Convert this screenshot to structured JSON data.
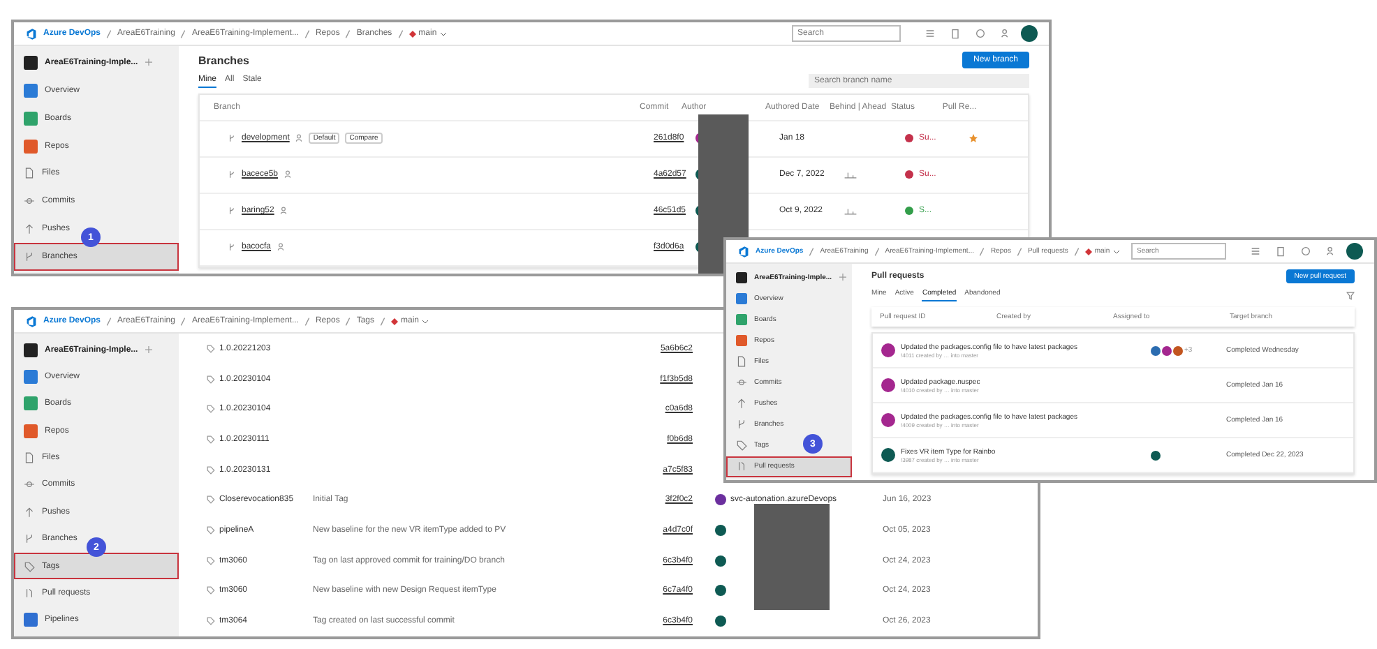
{
  "windows": [
    {
      "kind": "branches",
      "brand": "Azure DevOps",
      "crumbs": [
        "AreaE6Training",
        "AreaE6Training-Implement...",
        "Repos",
        "Branches"
      ],
      "branch": "main",
      "search_placeholder": "Search",
      "project": "AreaE6Training-Imple...",
      "step_badge": "1",
      "nav": [
        {
          "label": "Overview",
          "kind": "service",
          "color": "#2b7bd6",
          "selected": false
        },
        {
          "label": "Boards",
          "kind": "service",
          "color": "#2fa36b",
          "selected": false
        },
        {
          "label": "Repos",
          "kind": "service",
          "color": "#e0592a",
          "selected": false
        },
        {
          "label": "Files",
          "kind": "files",
          "selected": false
        },
        {
          "label": "Commits",
          "kind": "commits",
          "selected": false
        },
        {
          "label": "Pushes",
          "kind": "pushes",
          "selected": false
        },
        {
          "label": "Branches",
          "kind": "branches",
          "selected": true
        }
      ],
      "title": "Branches",
      "tabs": [
        {
          "label": "Mine",
          "selected": true
        },
        {
          "label": "All",
          "selected": false
        },
        {
          "label": "Stale",
          "selected": false
        }
      ],
      "button": "New branch",
      "filter_placeholder": "Search branch name",
      "columns": [
        "Branch",
        "Commit",
        "Author",
        "Authored Date",
        "Behind | Ahead",
        "Status",
        "Pull Re..."
      ],
      "rows": [
        {
          "name": "development",
          "tags": [
            "Default",
            "Compare"
          ],
          "commit": "261d8f0",
          "color": "#a4278f",
          "date": "Jan 18",
          "graph": false,
          "status": {
            "text": "Su...",
            "color": "#c4314b"
          },
          "pr_icon": true
        },
        {
          "name": "bacece5b",
          "tags": [],
          "commit": "4a62d57",
          "color": "#0e5a53",
          "date": "Dec 7, 2022",
          "graph": true,
          "status": {
            "text": "Su...",
            "color": "#c4314b"
          },
          "pr_icon": false
        },
        {
          "name": "baring52",
          "tags": [],
          "commit": "46c51d5",
          "color": "#0e5a53",
          "date": "Oct 9, 2022",
          "graph": true,
          "status": {
            "text": "S...",
            "color": "#339e4a"
          },
          "pr_icon": false
        },
        {
          "name": "bacocfa",
          "tags": [],
          "commit": "f3d0d6a",
          "color": "#0e5a53",
          "graph": false,
          "pr_icon": false
        }
      ]
    },
    {
      "kind": "tags",
      "brand": "Azure DevOps",
      "crumbs": [
        "AreaE6Training",
        "AreaE6Training-Implement...",
        "Repos",
        "Tags"
      ],
      "branch": "main",
      "project": "AreaE6Training-Imple...",
      "step_badge": "2",
      "nav": [
        {
          "label": "Overview",
          "kind": "service",
          "color": "#2b7bd6",
          "selected": false
        },
        {
          "label": "Boards",
          "kind": "service",
          "color": "#2fa36b",
          "selected": false
        },
        {
          "label": "Repos",
          "kind": "service",
          "color": "#e0592a",
          "selected": false
        },
        {
          "label": "Files",
          "kind": "files",
          "selected": false
        },
        {
          "label": "Commits",
          "kind": "commits",
          "selected": false
        },
        {
          "label": "Pushes",
          "kind": "pushes",
          "selected": false
        },
        {
          "label": "Branches",
          "kind": "branches",
          "selected": false
        },
        {
          "label": "Tags",
          "kind": "tags",
          "selected": true
        },
        {
          "label": "Pull requests",
          "kind": "pulls",
          "selected": false
        },
        {
          "label": "Pipelines",
          "kind": "service",
          "color": "#2f6fd1",
          "selected": false
        }
      ],
      "rows": [
        {
          "name": "1.0.20221203",
          "commit": "5a6b6c2"
        },
        {
          "name": "1.0.20230104",
          "commit": "f1f3b5d8"
        },
        {
          "name": "1.0.20230104",
          "commit": "c0a6d8"
        },
        {
          "name": "1.0.20230111",
          "commit": "f0b6d8"
        },
        {
          "name": "1.0.20230131",
          "commit": "a7c5f83"
        },
        {
          "name": "Closerevocation835",
          "message": "Initial Tag",
          "commit": "3f2f0c2",
          "color": "#6b2f9e",
          "author": "svc-autonation.azureDevops",
          "date": "Jun 16, 2023"
        },
        {
          "name": "pipelineA",
          "message": "New baseline for the new VR itemType added to PV",
          "commit": "a4d7c0f",
          "color": "#0e5a53",
          "date": "Oct 05, 2023"
        },
        {
          "name": "tm3060",
          "message": "Tag on last approved commit for training/DO branch",
          "commit": "6c3b4f0",
          "color": "#0e5a53",
          "date": "Oct 24, 2023"
        },
        {
          "name": "tm3060",
          "message": "New baseline with new Design Request itemType",
          "commit": "6c7a4f0",
          "color": "#0e5a53",
          "date": "Oct 24, 2023"
        },
        {
          "name": "tm3064",
          "message": "Tag created on last successful commit",
          "commit": "6c3b4f0",
          "color": "#0e5a53",
          "date": "Oct 26, 2023"
        }
      ]
    },
    {
      "kind": "pulls",
      "brand": "Azure DevOps",
      "crumbs": [
        "AreaE6Training",
        "AreaE6Training-Implement...",
        "Repos",
        "Pull requests"
      ],
      "branch": "main",
      "search_placeholder": "Search",
      "project": "AreaE6Training-Imple...",
      "step_badge": "3",
      "nav": [
        {
          "label": "Overview",
          "kind": "service",
          "color": "#2b7bd6",
          "selected": false
        },
        {
          "label": "Boards",
          "kind": "service",
          "color": "#2fa36b",
          "selected": false
        },
        {
          "label": "Repos",
          "kind": "service",
          "color": "#e0592a",
          "selected": false
        },
        {
          "label": "Files",
          "kind": "files",
          "selected": false
        },
        {
          "label": "Commits",
          "kind": "commits",
          "selected": false
        },
        {
          "label": "Pushes",
          "kind": "pushes",
          "selected": false
        },
        {
          "label": "Branches",
          "kind": "branches",
          "selected": false
        },
        {
          "label": "Tags",
          "kind": "tags",
          "selected": false
        },
        {
          "label": "Pull requests",
          "kind": "pulls",
          "selected": true
        }
      ],
      "title": "Pull requests",
      "button": "New pull request",
      "tabs": [
        {
          "label": "Mine",
          "selected": false
        },
        {
          "label": "Active",
          "selected": false
        },
        {
          "label": "Completed",
          "selected": true
        },
        {
          "label": "Abandoned",
          "selected": false
        }
      ],
      "filters": [
        "Pull request ID",
        "Created by",
        "Assigned to",
        "Target branch"
      ],
      "rows": [
        {
          "title": "Updated the packages.config file to have latest packages",
          "subtitle": "!4011 created by … into master",
          "color": "#a4278f",
          "reviewers": [
            {
              "color": "#2b6cb0"
            },
            {
              "color": "#a4278f"
            },
            {
              "color": "#c2551f"
            }
          ],
          "reviewer_count": "+3",
          "status": "Completed Wednesday"
        },
        {
          "title": "Updated package.nuspec",
          "subtitle": "!4010 created by … into master",
          "color": "#a4278f",
          "reviewers": [],
          "status": "Completed Jan 16"
        },
        {
          "title": "Updated the packages.config file to have latest packages",
          "subtitle": "!4009 created by … into master",
          "color": "#a4278f",
          "reviewers": [],
          "status": "Completed Jan 16"
        },
        {
          "title": "Fixes VR item Type for Rainbo",
          "subtitle": "!3987 created by … into master",
          "color": "#0e5a53",
          "reviewers": [
            {
              "color": "#0e5a53"
            }
          ],
          "status": "Completed Dec 22, 2023"
        }
      ]
    }
  ]
}
